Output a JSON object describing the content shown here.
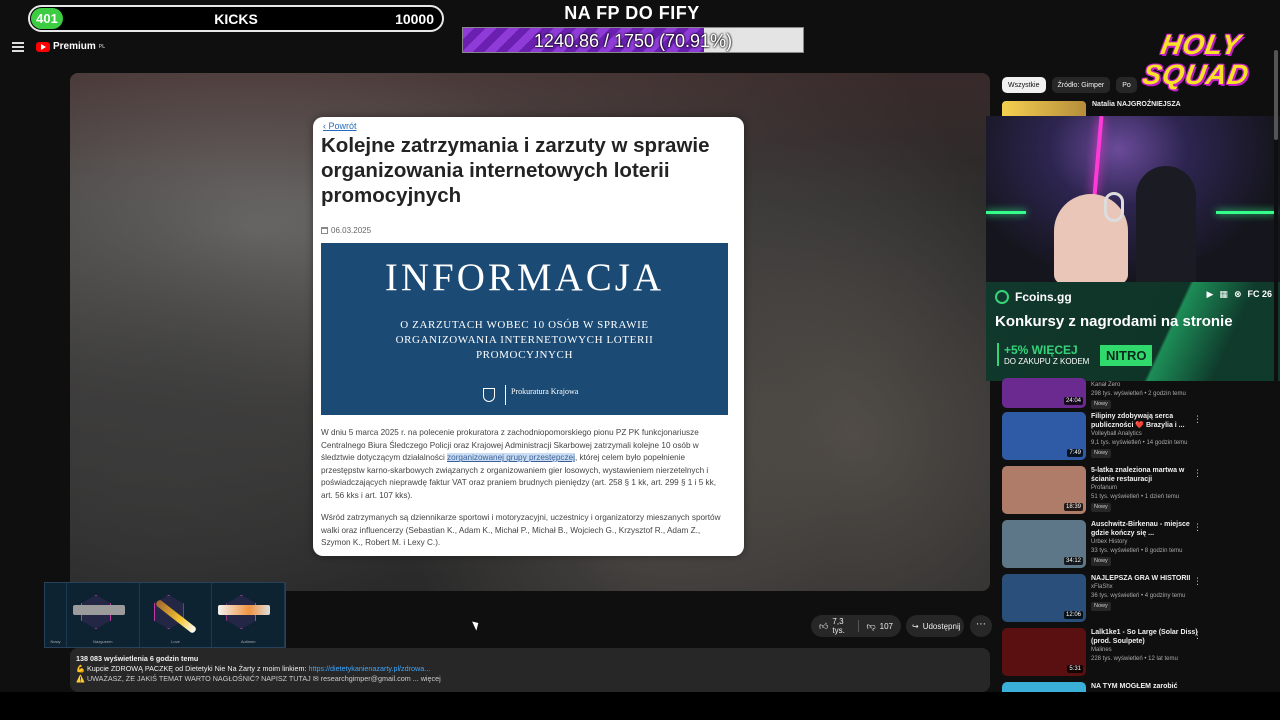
{
  "overlay": {
    "kicks_count": "401",
    "kicks_label": "KICKS",
    "kicks_goal": "10000",
    "fp_title": "NA FP DO FIFY",
    "fp_progress_text": "1240.86 / 1750 (70.91%)",
    "fp_progress_fraction": 0.7091,
    "brand_logo": "HOLY SQUAD"
  },
  "header": {
    "logo": "Premium",
    "logo_sup": "PL"
  },
  "article": {
    "back": "Powrót",
    "title": "Kolejne zatrzymania i zarzuty w sprawie organizowania internetowych loterii promocyjnych",
    "date": "06.03.2025",
    "banner_big": "INFORMACJA",
    "banner_small": "O ZARZUTACH WOBEC 10 OSÓB W SPRAWIE ORGANIZOWANIA INTERNETOWYCH LOTERII PROMOCYJNYCH",
    "banner_institution": "Prokuratura Krajowa",
    "para1_a": "W dniu 5 marca 2025 r. na polecenie prokuratora z zachodniopomorskiego pionu PZ PK funkcjonariusze Centralnego Biura Śledczego Policji oraz Krajowej Administracji Skarbowej zatrzymali kolejne 10 osób w śledztwie dotyczącym działalności ",
    "para1_hl": "zorganizowanej grupy przestępczej",
    "para1_b": ", której celem było popełnienie przestępstw karno-skarbowych związanych z organizowaniem gier losowych, wystawieniem nierzetelnych i poświadczających nieprawdę faktur VAT oraz praniem brudnych pieniędzy (art. 258 § 1 kk, art. 299 § 1 i 5 kk, art. 56 kks i art. 107 kks).",
    "para2": "Wśród zatrzymanych są dziennikarze sportowi i motoryzacyjni, uczestnicy i organizatorzy mieszanych sportów walki oraz influencerzy (Sebastian K., Adam K., Michał P., Michał B., Wojciech G., Krzysztof R., Adam Z., Szymon K., Robert M. i Lexy C.)."
  },
  "game": {
    "labels": [
      "Nowy",
      "Nazgusern",
      "Love",
      "Autimon"
    ]
  },
  "actions": {
    "likes": "7,3 tys.",
    "dislikes": "107",
    "share": "Udostępnij",
    "more": "⋯"
  },
  "description": {
    "stats": "138 083 wyświetlenia  6 godzin temu",
    "line2_text": "💪 Kupcie ZDROWĄ PACZKĘ od Dietetyki Nie Na Żarty z moim linkiem: ",
    "line2_link": "https://dietetykanienazarty.pl/zdrowa...",
    "line3": "⚠️ UWAŻASZ, ŻE JAKIŚ TEMAT WARTO NAGŁOŚNIĆ? NAPISZ TUTAJ ✉ researchgimper@gmail.com ... więcej"
  },
  "chips": [
    "Wszystkie",
    "Źródło: Gimper",
    "Po"
  ],
  "natalia": {
    "title": "Natalia NAJGROŹNIEJSZA"
  },
  "promo": {
    "brand": "Fcoins.gg",
    "platforms": "FC 26",
    "headline": "Konkursy z nagrodami na stronie",
    "deal1": "+5% WIĘCEJ",
    "deal2": "DO ZAKUPU Z KODEM",
    "code": "NITRO"
  },
  "videos": [
    {
      "title": "",
      "channel": "Kanał Zero",
      "stats": "298 tys. wyświetleń • 2 godzin temu",
      "badge": "Nowy",
      "duration": "24:04",
      "thumb": "#6a2a8f"
    },
    {
      "title": "Filipiny zdobywają serca publiczności ❤️ Brazylia i ...",
      "channel": "Volleyball Analytics",
      "stats": "9,1 tys. wyświetleń • 14 godzin temu",
      "badge": "Nowy",
      "duration": "7:49",
      "thumb": "#2f5aa5"
    },
    {
      "title": "5-latka znaleziona martwa w ścianie restauracji",
      "channel": "Profanum",
      "stats": "51 tys. wyświetleń • 1 dzień temu",
      "badge": "Nowy",
      "duration": "18:39",
      "thumb": "#b07c6a"
    },
    {
      "title": "Auschwitz-Birkenau - miejsce gdzie kończy się ...",
      "channel": "Urbex History",
      "stats": "33 tys. wyświetleń • 8 godzin temu",
      "badge": "Nowy",
      "duration": "34:12",
      "thumb": "#5d7788"
    },
    {
      "title": "NAJLEPSZA GRA W HISTORII",
      "channel": "xFlaShx",
      "stats": "36 tys. wyświetleń • 4 godziny temu",
      "badge": "Nowy",
      "duration": "12:06",
      "thumb": "#2a4f7a"
    },
    {
      "title": "Lalk1ke1 - So Large (Solar Diss) (prod. Soulpete)",
      "channel": "Malines",
      "stats": "228 tys. wyświetleń • 12 lat temu",
      "badge": "",
      "duration": "5:31",
      "thumb": "#5a1010"
    },
    {
      "title": "NA TYM MOGŁEM zarobić",
      "channel": "",
      "stats": "",
      "badge": "",
      "duration": "",
      "thumb": "#3ab0d9"
    }
  ]
}
